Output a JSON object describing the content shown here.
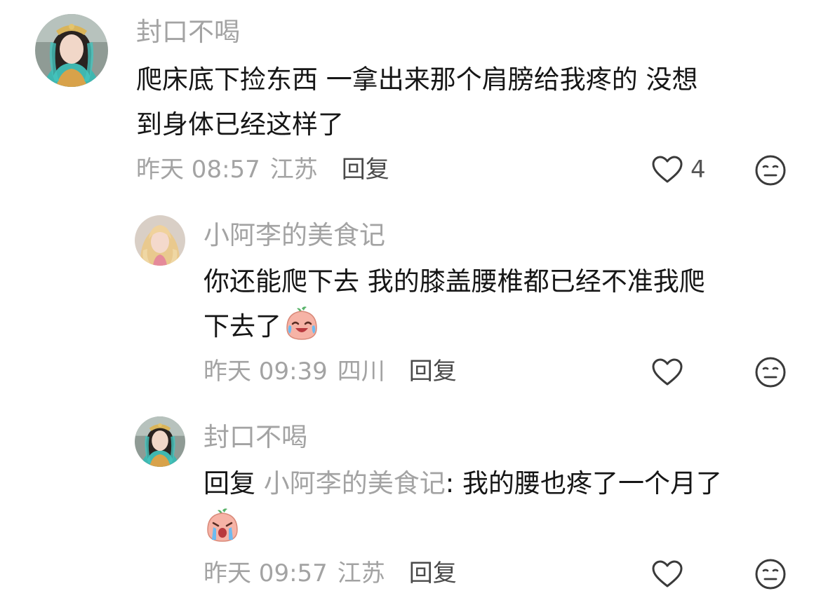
{
  "comments": [
    {
      "username": "封口不喝",
      "content_line1": "爬床底下捡东西 一拿出来那个肩膀给我疼的 没想",
      "content_line2": "到身体已经这样了",
      "time": "昨天 08:57",
      "location": "江苏",
      "reply_label": "回复",
      "like_count": "4",
      "avatar_icon": "user-avatar-costume"
    },
    {
      "username": "小阿李的美食记",
      "content_line1": "你还能爬下去 我的膝盖腰椎都已经不准我爬",
      "content_line2": "下去了",
      "emoji": "crying-laughing-peach-emoji",
      "time": "昨天 09:39",
      "location": "四川",
      "reply_label": "回复",
      "like_count": "",
      "avatar_icon": "user-avatar-blonde"
    },
    {
      "username": "封口不喝",
      "reply_prefix": "回复",
      "reply_target": "小阿李的美食记",
      "content_line1": ": 我的腰也疼了一个月了",
      "emoji": "crying-peach-emoji",
      "time": "昨天 09:57",
      "location": "江苏",
      "reply_label": "回复",
      "like_count": "",
      "avatar_icon": "user-avatar-costume"
    }
  ],
  "icons": {
    "like": "heart-outline-icon",
    "dislike": "neutral-face-icon"
  },
  "colors": {
    "text_primary": "#161616",
    "text_secondary": "#a3a3a3",
    "reply_button": "#4a4a4a",
    "icon_stroke": "#3a3a3a"
  }
}
